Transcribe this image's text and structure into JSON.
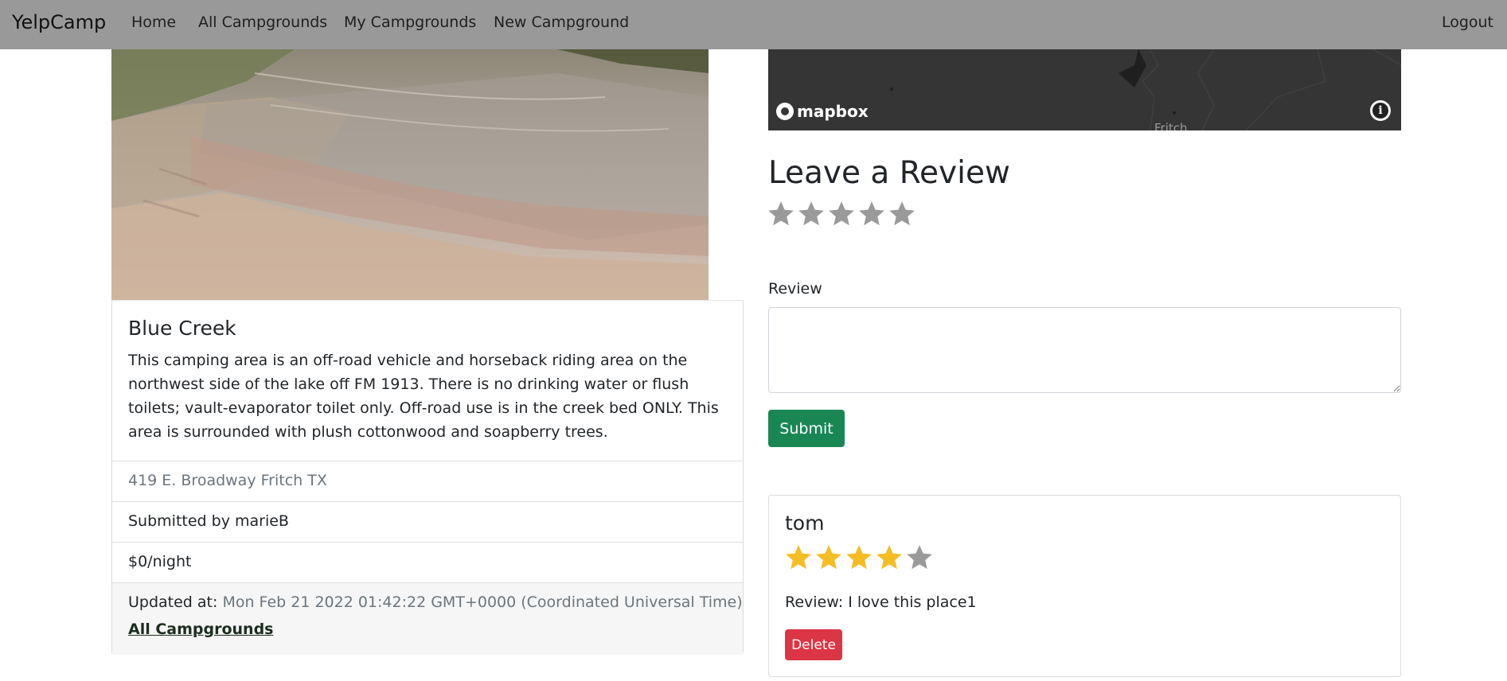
{
  "navbar": {
    "brand": "YelpCamp",
    "links": [
      "Home",
      "All Campgrounds",
      "My Campgrounds",
      "New Campground"
    ],
    "logout": "Logout"
  },
  "campground": {
    "title": "Blue Creek",
    "description": "This camping area is an off-road vehicle and horseback riding area on the northwest side of the lake off FM 1913. There is no drinking water or flush toilets; vault-evaporator toilet only. Off-road use is in the creek bed ONLY. This area is surrounded with plush cottonwood and soapberry trees.",
    "location": "419 E. Broadway Fritch TX",
    "submitted_by": "Submitted by marieB",
    "price": "$0/night",
    "updated_label": "Updated at:",
    "updated_value": "Mon Feb 21 2022 01:42:22 GMT+0000 (Coordinated Universal Time)",
    "all_link": "All Campgrounds"
  },
  "map": {
    "logo": "mapbox",
    "place_label": "Fritch",
    "info_icon": "i"
  },
  "review_form": {
    "heading": "Leave a Review",
    "rating": 0,
    "label": "Review",
    "value": "",
    "submit": "Submit"
  },
  "reviews": [
    {
      "author": "tom",
      "rating": 4,
      "text": "Review: I love this place1",
      "delete": "Delete"
    }
  ],
  "colors": {
    "navbar": "#999999",
    "star_filled": "#f5bd25",
    "star_empty": "#9a9a9a",
    "submit": "#198754",
    "delete": "#dc3545"
  }
}
